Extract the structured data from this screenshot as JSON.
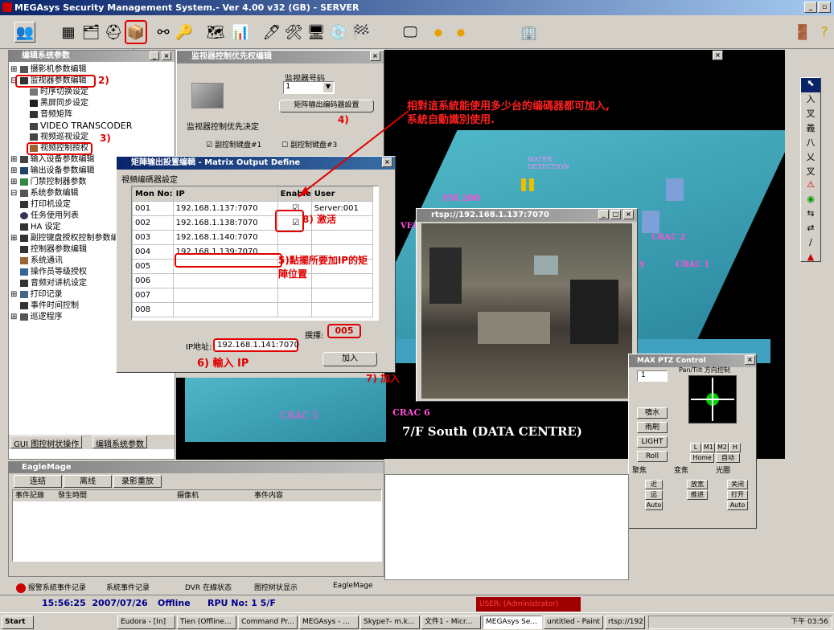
{
  "app": {
    "title": "MEGAsys Security Management System.- Ver 4.00 v32 (GB) - SERVER"
  },
  "annotations": {
    "a1": "1)",
    "a2": "2)",
    "a3": "3)",
    "a4": "4)",
    "a5": "5)點擺所要加IP的矩",
    "a5b": "陣位置",
    "a6": "6) 輸入 IP",
    "a7": "7) 加入",
    "a8": "8) 激活",
    "note1": "相對這系統能使用多少台的编碼器都可加入,",
    "note2": "系統自動識別使用."
  },
  "editpanel": {
    "title": "编辑系统参数",
    "items": [
      "摄影机参数编辑",
      "监视器参数编辑",
      "时序切换设定",
      "黑屏同步设定",
      "音频矩阵",
      "VIDEO TRANSCODER",
      "视频巡视设定",
      "视频控制授权",
      "输入设备参数编辑",
      "输出设备参数编辑",
      "门禁控制器参数",
      "系统参数编辑",
      "打印机设定",
      "任务使用列表",
      "HA 设定",
      "副控键盘授权控制参数编",
      "控制器参数编辑",
      "系统通讯",
      "操作员等级授权",
      "音频对讲机设定",
      "打印记录",
      "事件时间控制",
      "巡逻程序"
    ],
    "tabs": [
      "GUI 图控树状操作",
      "编辑系统参数"
    ]
  },
  "monitorwin": {
    "title": "监视器控制优先权编辑",
    "monitor_label": "监视器号码",
    "monitor_value": "1",
    "matrix_btn": "矩阵输出编码器設置",
    "group_label": "监视器控制优先决定",
    "kb1": "副控制键盘#1",
    "kb3": "副控制键盘#3"
  },
  "matrix": {
    "title": "矩陣输出設置编輯 - Matrix Output Define",
    "group": "視頻编碼器設定",
    "headers": [
      "Mon No:",
      "IP",
      "Enable",
      "User"
    ],
    "rows": [
      {
        "no": "001",
        "ip": "192.168.1.137:7070",
        "enabled": true,
        "user": "Server:001"
      },
      {
        "no": "002",
        "ip": "192.168.1.138:7070",
        "enabled": true,
        "user": ""
      },
      {
        "no": "003",
        "ip": "192.168.1.140:7070",
        "enabled": false,
        "user": ""
      },
      {
        "no": "004",
        "ip": "192.168.1.139:7070",
        "enabled": false,
        "user": ""
      },
      {
        "no": "005",
        "ip": "",
        "enabled": false,
        "user": ""
      },
      {
        "no": "006",
        "ip": "",
        "enabled": false,
        "user": ""
      },
      {
        "no": "007",
        "ip": "",
        "enabled": false,
        "user": ""
      },
      {
        "no": "008",
        "ip": "",
        "enabled": false,
        "user": ""
      }
    ],
    "select_label": "撰擇:",
    "select_value": "005",
    "ip_label": "IP地址:",
    "ip_value": "192.168.1.141:7070",
    "add_btn": "加入"
  },
  "rtsp": {
    "title": "rtsp://192.168.1.137:7070"
  },
  "scene": {
    "water": "WATER",
    "detect": "DETECTION",
    "fm": "FM 200",
    "crac1": "CRAC 1",
    "crac2": "CRAC 2",
    "crac5": "CRAC 5",
    "crac6": "CRAC 6",
    "ves": "VES",
    "three": "3",
    "caption": "7/F South (DATA CENTRE)"
  },
  "ptz": {
    "title": "MAX PTZ Control",
    "pantilt": "Pan/Tilt 方向控制",
    "num": "1",
    "wash": "噴水",
    "wiper": "雨刷",
    "light": "LIGHT",
    "roll": "Roll",
    "L": "L",
    "M1": "M1",
    "M2": "M2",
    "H": "H",
    "home": "Home",
    "auto": "自动",
    "zoom": "聚焦",
    "focus": "变焦",
    "iris": "光圈",
    "near": "近",
    "far": "远",
    "auto2": "Auto",
    "wide": "放宽",
    "tele": "推进",
    "close": "关闭",
    "open": "打开",
    "auto3": "Auto"
  },
  "eagle": {
    "title": "EagleMage",
    "connect": "连结",
    "disconnect": "离线",
    "playback": "录影重放",
    "cols": [
      "事件記錄",
      "發生時間",
      "摄像机",
      "事件内容"
    ]
  },
  "bottomtabs": [
    "报警系統事件记录",
    "系統事件记录",
    "DVR 在線状态",
    "图控树状显示",
    "EagleMage"
  ],
  "status": {
    "time": "15:56:25",
    "date": "2007/07/26",
    "mode": "Offline",
    "rpu": "RPU No: 1 5/F",
    "user": "USER: (Administrator)"
  },
  "taskbar": {
    "start": "Start",
    "items": [
      "Eudora - [In]",
      "Tien (Offline...",
      "Command Pr...",
      "MEGAsys - ...",
      "Skype?- m.k...",
      "文件1 - Micr...",
      "MEGAsys Se...",
      "untitled - Paint",
      "rtsp://192.1..."
    ],
    "clock": "下午 03:56"
  }
}
